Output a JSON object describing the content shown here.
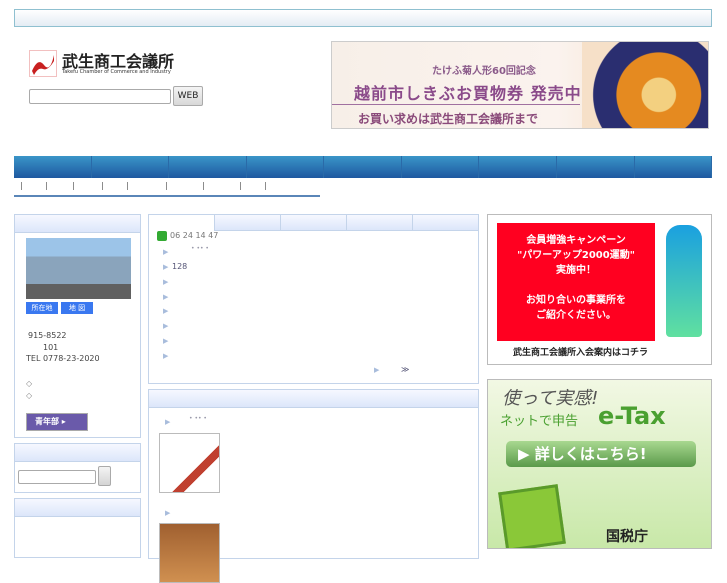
{
  "header": {
    "logo_jp": "武生商工会議所",
    "logo_en": "Takefu Chamber of Commerce and Industry",
    "search_placeholder": "",
    "search_button": "WEB"
  },
  "banner": {
    "line1": "たけふ菊人形60回記念",
    "line2": "越前市しきぶお買物券 発売中！",
    "line3": "お買い求めは武生商工会議所まで"
  },
  "subnav": [
    "|",
    "|",
    "|",
    "|",
    "|",
    "|",
    "|",
    "|",
    "|"
  ],
  "sidebar": {
    "location_btn": "所在地",
    "map_btn": "地 図",
    "postal": "915-8522",
    "address_no": "101",
    "tel": "TEL 0778-23-2020",
    "diamond1": "◇",
    "diamond2": "◇",
    "youth_btn": "青年部 ▸"
  },
  "news": {
    "timestamp": "06 24  14 47",
    "item1_dots": "•  ••  •",
    "item2": "128",
    "more": "≫"
  },
  "features": {
    "item1_dots": "•  ••  •"
  },
  "ads": {
    "campaign_lines": [
      "会員増強キャンペーン",
      "\"パワーアップ2000運動\"",
      "実施中！",
      "",
      "お知り合いの事業所を",
      "ご紹介ください。"
    ],
    "campaign_caption": "武生商工会議所入会案内はコチラ",
    "etax_l1": "使って実感!",
    "etax_l2": "ネットで申告",
    "etax_l3": "e-Tax",
    "etax_btn": "▶ 詳しくはこちら!",
    "etax_org": "国税庁"
  }
}
